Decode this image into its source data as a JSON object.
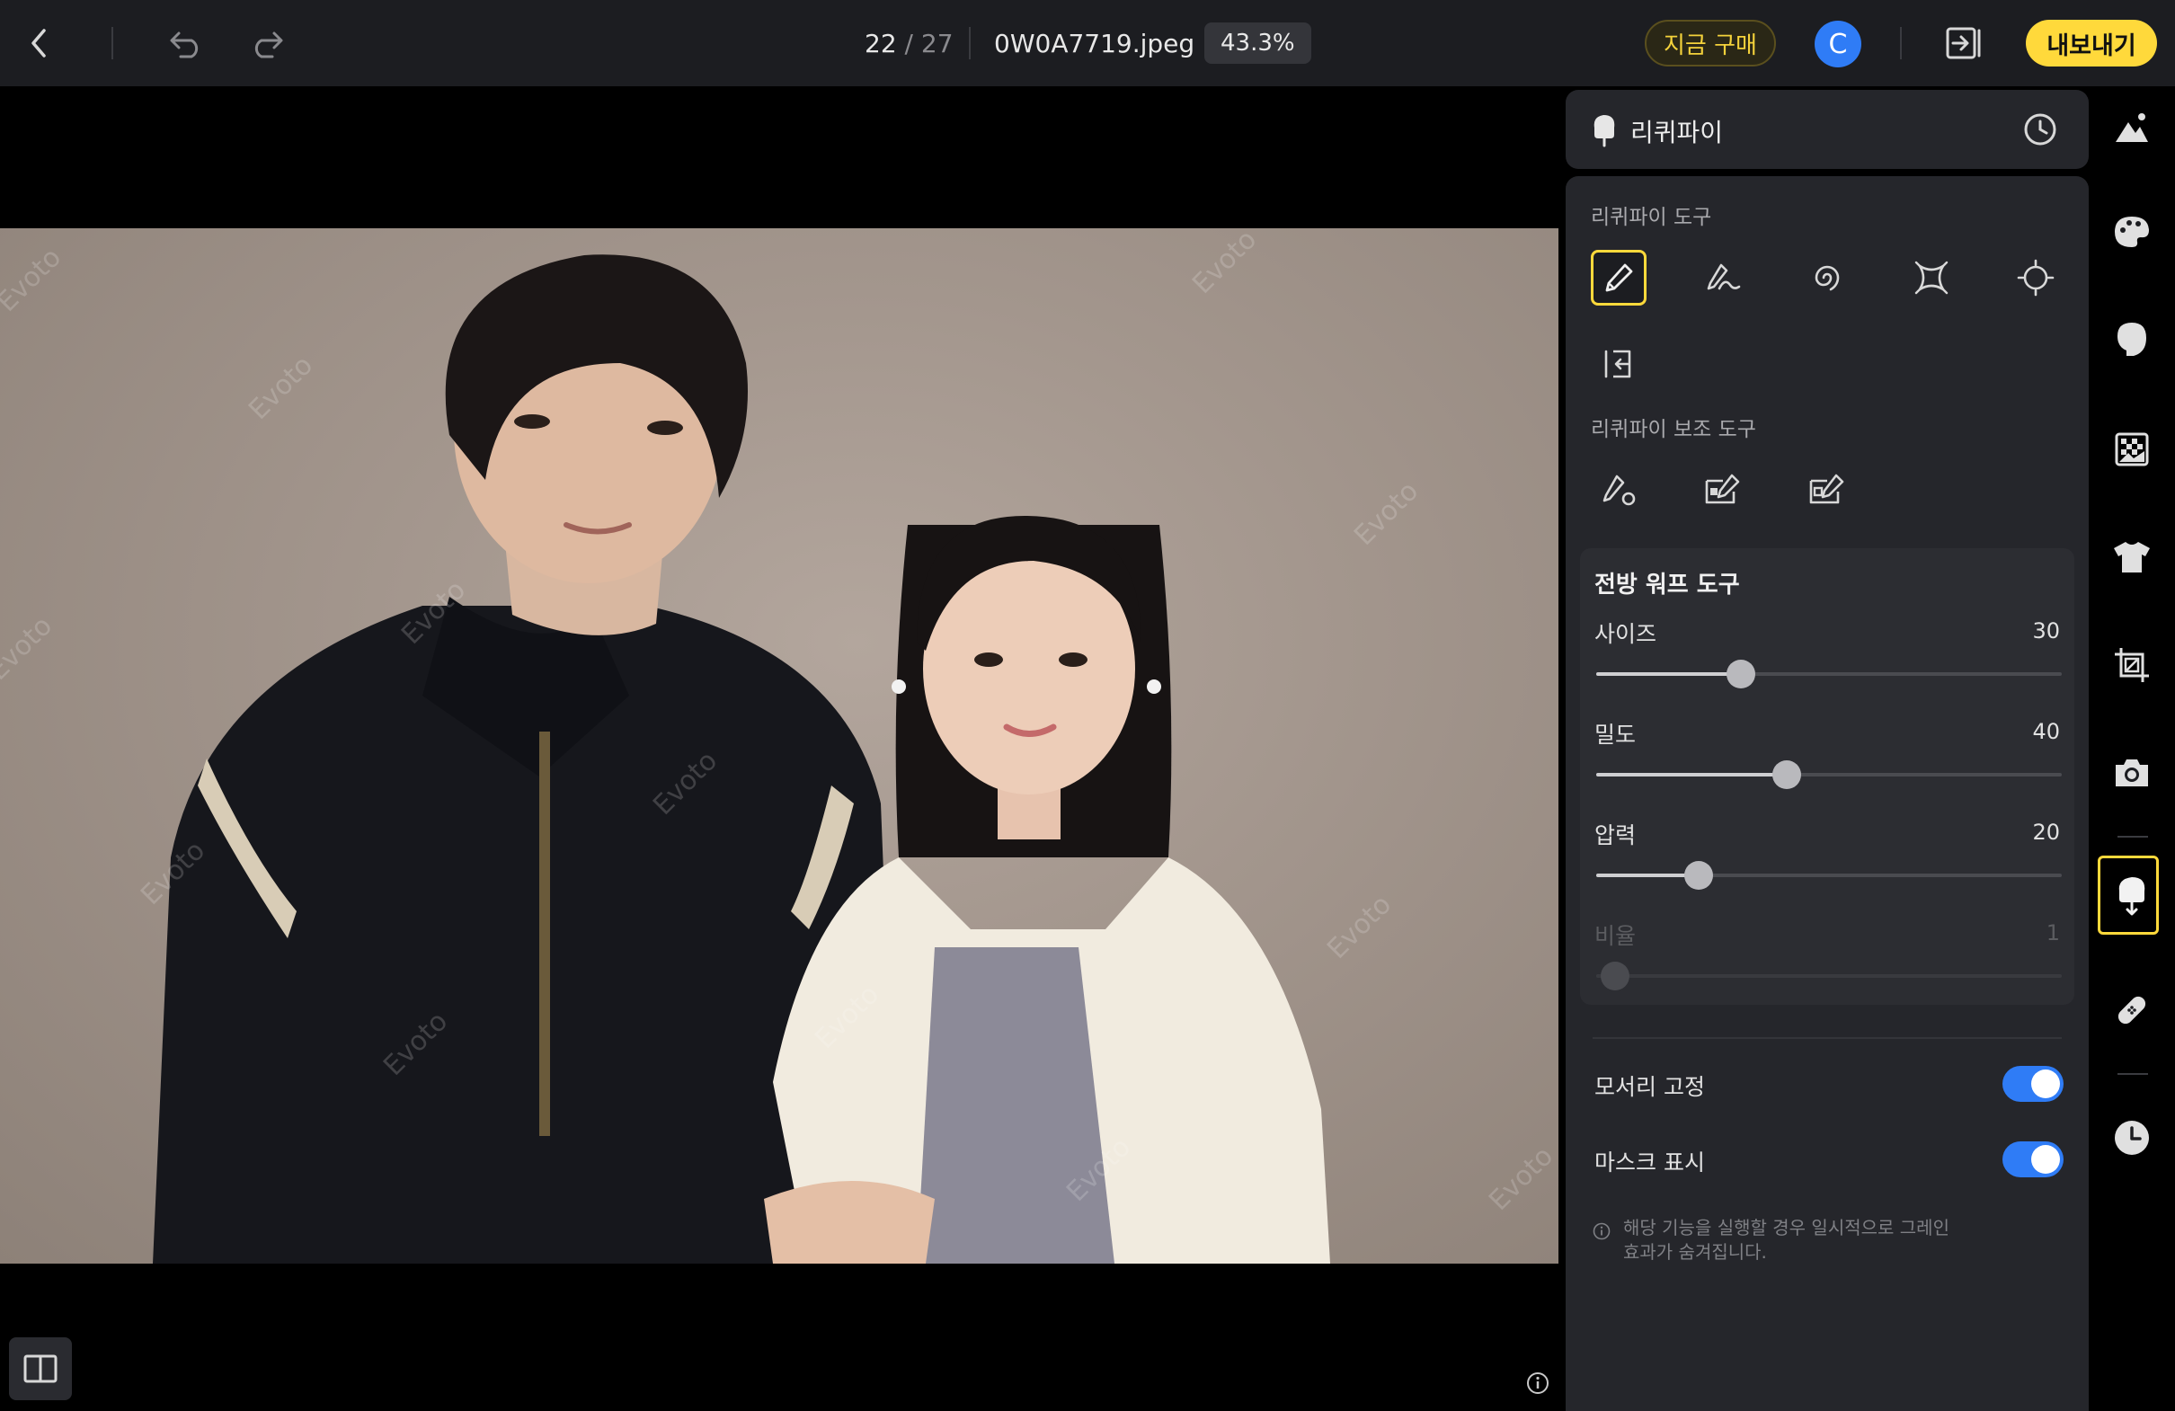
{
  "topbar": {
    "back_icon": "chevron-left-icon",
    "undo_icon": "undo-icon",
    "redo_icon": "redo-icon",
    "counter_current": "22",
    "counter_sep": " / ",
    "counter_total": "27",
    "filename": "0W0A7719.jpeg",
    "zoom": "43.3%",
    "buy_label": "지금 구매",
    "avatar_letter": "C",
    "panel_toggle_icon": "panel-collapse-icon",
    "export_label": "내보내기"
  },
  "canvas": {
    "watermark_text": "Evoto",
    "compare_icon": "compare-split-icon",
    "info_icon": "info-icon"
  },
  "panel": {
    "title": "리퀴파이",
    "history_icon": "clock-icon",
    "tools_label": "리퀴파이 도구",
    "tools": [
      {
        "icon": "forward-warp-brush-icon",
        "active": true
      },
      {
        "icon": "reconstruct-brush-icon",
        "active": false
      },
      {
        "icon": "twirl-icon",
        "active": false
      },
      {
        "icon": "pucker-icon",
        "active": false
      },
      {
        "icon": "bloat-icon",
        "active": false
      },
      {
        "icon": "push-left-icon",
        "active": false
      }
    ],
    "aux_label": "리퀴파이 보조 도구",
    "aux_tools": [
      {
        "icon": "freeze-brush-icon"
      },
      {
        "icon": "freeze-mask-icon"
      },
      {
        "icon": "thaw-mask-icon"
      }
    ],
    "warp": {
      "title": "전방 워프 도구",
      "size_label": "사이즈",
      "size_value": "30",
      "size_fraction": 0.31,
      "density_label": "밀도",
      "density_value": "40",
      "density_fraction": 0.41,
      "pressure_label": "압력",
      "pressure_value": "20",
      "pressure_fraction": 0.22,
      "ratio_label": "비율",
      "ratio_value": "1",
      "ratio_fraction": 0.04
    },
    "pin_edges_label": "모서리 고정",
    "pin_edges_on": true,
    "show_mask_label": "마스크 표시",
    "show_mask_on": true,
    "note_line1": "해당 기능을 실행할 경우 일시적으로 그레인",
    "note_line2": "효과가 숨겨집니다."
  },
  "rail": [
    {
      "icon": "adjust-mountain-icon"
    },
    {
      "icon": "palette-icon"
    },
    {
      "icon": "face-head-icon"
    },
    {
      "icon": "background-checker-icon"
    },
    {
      "icon": "tshirt-icon"
    },
    {
      "icon": "crop-icon"
    },
    {
      "icon": "camera-icon"
    },
    {
      "icon": "liquify-hand-icon",
      "active": true
    },
    {
      "icon": "bandage-icon"
    },
    {
      "icon": "history-clock-icon"
    }
  ],
  "colors": {
    "accent_yellow": "#ffd93b",
    "toggle_blue": "#2f7cf6",
    "panel_bg": "#25262b",
    "topbar_bg": "#1c1d21"
  }
}
